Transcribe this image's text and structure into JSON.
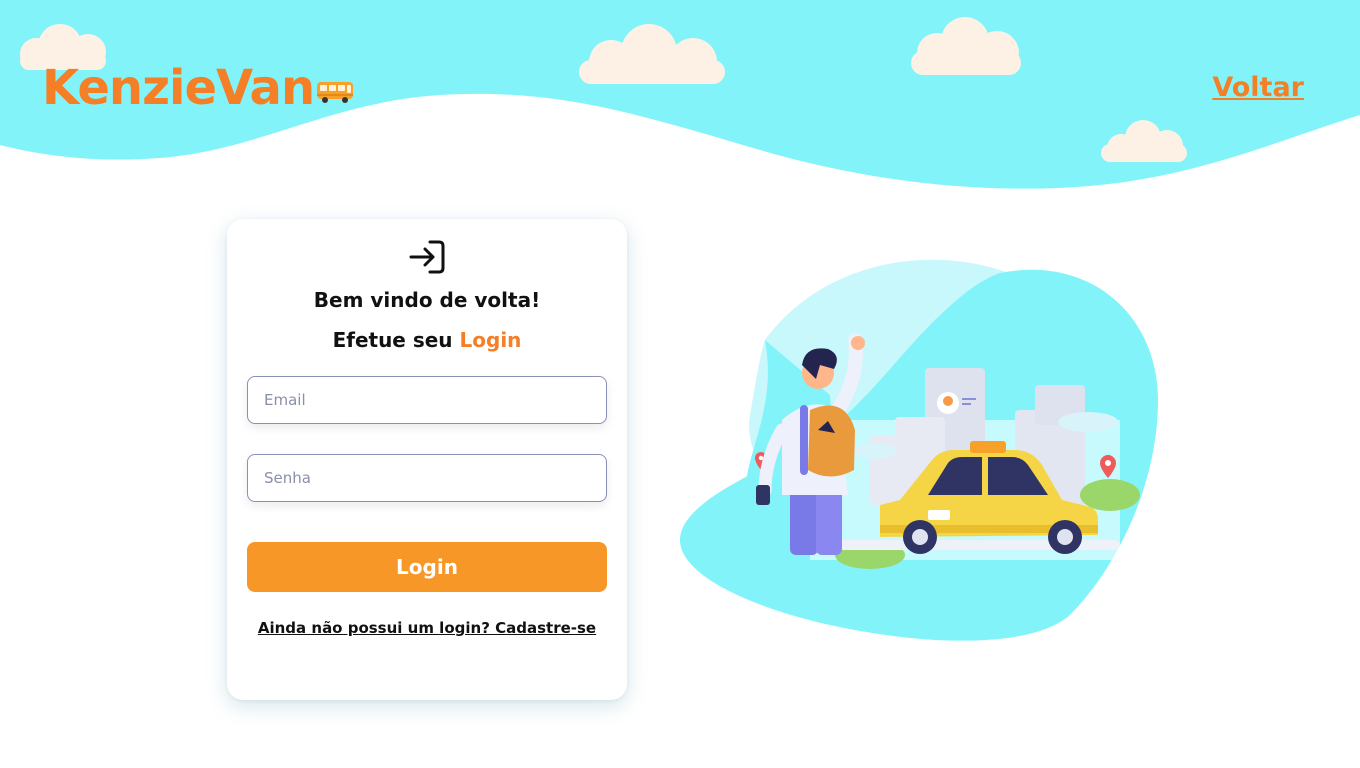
{
  "header": {
    "logo_text": "KenzieVan",
    "logo_icon": "van-icon",
    "back_link": "Voltar"
  },
  "login_card": {
    "icon": "login-arrow-icon",
    "welcome": "Bem vindo de volta!",
    "subtitle_prefix": "Efetue seu",
    "subtitle_accent": "Login",
    "email_placeholder": "Email",
    "email_value": "",
    "password_placeholder": "Senha",
    "password_value": "",
    "submit_label": "Login",
    "signup_link": "Ainda não possui um login? Cadastre-se"
  },
  "illustration": {
    "icon": "taxi-passenger-illustration"
  },
  "colors": {
    "sky": "#83f3fa",
    "brand": "#f47f27",
    "button": "#f79727",
    "cloud": "#fdf1e6"
  }
}
